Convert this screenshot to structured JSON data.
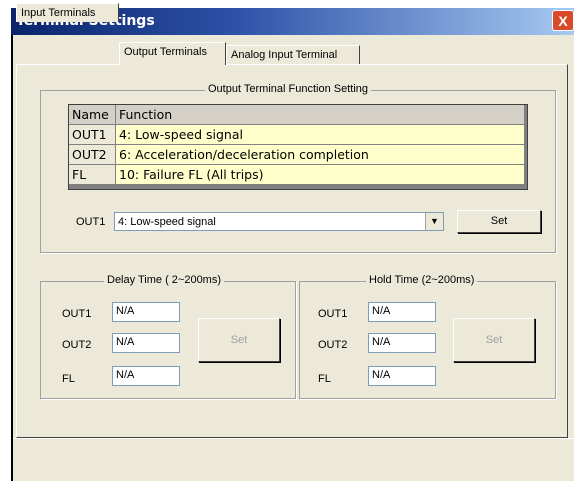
{
  "window": {
    "title": "Terminal Settings",
    "close_glyph": "X"
  },
  "tabs": [
    {
      "label": "Input Terminals"
    },
    {
      "label": "Output Terminals"
    },
    {
      "label": "Analog Input Terminal"
    }
  ],
  "function_group": {
    "title": "Output Terminal Function Setting",
    "columns": [
      "Name",
      "Function"
    ],
    "rows": [
      {
        "name": "OUT1",
        "function": "4: Low-speed signal"
      },
      {
        "name": "OUT2",
        "function": "6: Acceleration/deceleration completion"
      },
      {
        "name": "FL",
        "function": "10: Failure FL (All trips)"
      }
    ],
    "select_label": "OUT1",
    "select_value": "4: Low-speed signal",
    "set_label": "Set"
  },
  "delay_group": {
    "title": "Delay Time ( 2~200ms)",
    "fields": [
      {
        "label": "OUT1",
        "value": "N/A"
      },
      {
        "label": "OUT2",
        "value": "N/A"
      },
      {
        "label": "FL",
        "value": "N/A"
      }
    ],
    "set_label": "Set"
  },
  "hold_group": {
    "title": "Hold Time (2~200ms)",
    "fields": [
      {
        "label": "OUT1",
        "value": "N/A"
      },
      {
        "label": "OUT2",
        "value": "N/A"
      },
      {
        "label": "FL",
        "value": "N/A"
      }
    ],
    "set_label": "Set"
  }
}
